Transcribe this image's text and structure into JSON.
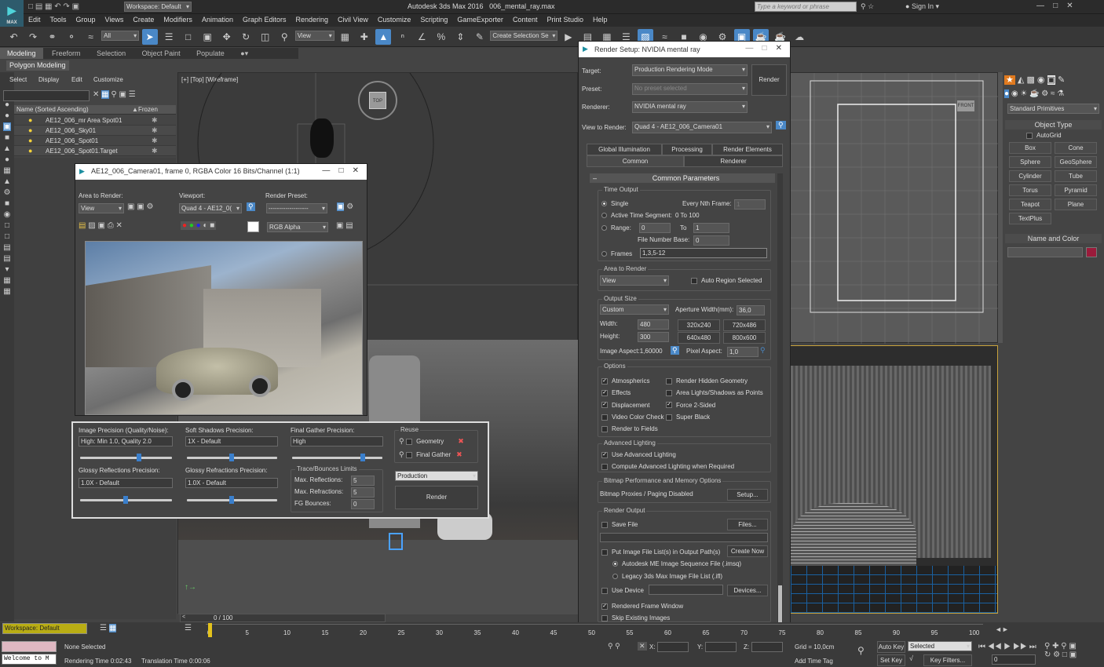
{
  "title": {
    "app": "Autodesk 3ds Max 2016",
    "file": "006_mental_ray.max",
    "workspace": "Workspace: Default",
    "search_placeholder": "Type a keyword or phrase",
    "sign_in": "Sign In"
  },
  "menu": [
    "Edit",
    "Tools",
    "Group",
    "Views",
    "Create",
    "Modifiers",
    "Animation",
    "Graph Editors",
    "Rendering",
    "Civil View",
    "Customize",
    "Scripting",
    "GameExporter",
    "Content",
    "Print Studio",
    "Help"
  ],
  "toolbar": {
    "filter": "All",
    "refcoord": "View",
    "selection_set": "Create Selection Se"
  },
  "ribbon": {
    "tabs": [
      "Modeling",
      "Freeform",
      "Selection",
      "Object Paint",
      "Populate"
    ],
    "sub": "Polygon Modeling"
  },
  "explorer": {
    "menu": [
      "Select",
      "Display",
      "Edit",
      "Customize"
    ],
    "col_name": "Name (Sorted Ascending)",
    "col_frozen": "Frozen",
    "rows": [
      "AE12_006_mr Area Spot01",
      "AE12_006_Sky01",
      "AE12_006_Spot01",
      "AE12_006_Spot01.Target"
    ]
  },
  "viewport": {
    "label": "[+] [Top] [Wireframe]",
    "cube": "TOP",
    "timeline": "0 / 100",
    "front": "FRONT"
  },
  "frame_window": {
    "title": "AE12_006_Camera01, frame 0, RGBA Color 16 Bits/Channel (1:1)",
    "area_label": "Area to Render:",
    "area_value": "View",
    "viewport_label": "Viewport:",
    "viewport_value": "Quad 4 - AE12_0(",
    "preset_label": "Render Preset:",
    "preset_value": "-------------------",
    "channel": "RGB Alpha"
  },
  "render_panel": {
    "image_precision_label": "Image Precision (Quality/Noise):",
    "image_precision": "High: Min 1.0, Quality 2.0",
    "soft_shadows_label": "Soft Shadows Precision:",
    "soft_shadows": "1X - Default",
    "final_gather_label": "Final Gather Precision:",
    "final_gather": "High",
    "reuse": "Reuse",
    "geometry": "Geometry",
    "final_gather_cb": "Final Gather",
    "glossy_refl_label": "Glossy Reflections Precision:",
    "glossy_refl": "1.0X - Default",
    "glossy_refr_label": "Glossy Refractions Precision:",
    "glossy_refr": "1.0X - Default",
    "trace_label": "Trace/Bounces Limits",
    "max_refl": "Max. Reflections:",
    "max_refl_v": "5",
    "max_refr": "Max. Refractions:",
    "max_refr_v": "5",
    "fg_bounces": "FG Bounces:",
    "fg_bounces_v": "0",
    "mode": "Production",
    "render": "Render"
  },
  "render_setup": {
    "title": "Render Setup: NVIDIA mental ray",
    "target_label": "Target:",
    "target": "Production Rendering Mode",
    "preset_label": "Preset:",
    "preset": "No preset selected",
    "renderer_label": "Renderer:",
    "renderer": "NVIDIA mental ray",
    "view_label": "View to Render:",
    "view": "Quad 4 - AE12_006_Camera01",
    "render_btn": "Render",
    "tabs_row1": [
      "Global Illumination",
      "Processing",
      "Render Elements"
    ],
    "tabs_row2": [
      "Common",
      "Renderer"
    ],
    "rollout": "Common Parameters",
    "time_output": "Time Output",
    "single": "Single",
    "every_nth": "Every Nth Frame:",
    "every_nth_v": "1",
    "active_segment": "Active Time Segment:",
    "active_segment_v": "0 To 100",
    "range": "Range:",
    "range_from": "0",
    "range_to_label": "To",
    "range_to": "1",
    "file_number_base": "File Number Base:",
    "file_number_base_v": "0",
    "frames": "Frames",
    "frames_v": "1,3,5-12",
    "area_to_render": "Area to Render",
    "area_value": "View",
    "auto_region": "Auto Region Selected",
    "output_size": "Output Size",
    "size_preset": "Custom",
    "aperture": "Aperture Width(mm):",
    "aperture_v": "36,0",
    "width_label": "Width:",
    "width": "480",
    "height_label": "Height:",
    "height": "300",
    "presets": [
      "320x240",
      "720x486",
      "640x480",
      "800x600"
    ],
    "image_aspect": "Image Aspect:1,60000",
    "pixel_aspect": "Pixel Aspect:",
    "pixel_aspect_v": "1,0",
    "options": "Options",
    "opts_left": [
      "Atmospherics",
      "Effects",
      "Displacement",
      "Video Color Check",
      "Render to Fields"
    ],
    "opts_left_checked": [
      true,
      true,
      true,
      false,
      false
    ],
    "opts_right": [
      "Render Hidden Geometry",
      "Area Lights/Shadows as Points",
      "Force 2-Sided",
      "Super Black"
    ],
    "opts_right_checked": [
      false,
      false,
      true,
      false
    ],
    "adv_lighting": "Advanced Lighting",
    "use_adv": "Use Advanced Lighting",
    "compute_adv": "Compute Advanced Lighting when Required",
    "bitmap_perf": "Bitmap Performance and Memory Options",
    "bitmap_proxies": "Bitmap Proxies / Paging Disabled",
    "setup": "Setup...",
    "render_output": "Render Output",
    "save_file": "Save File",
    "files": "Files...",
    "put_image": "Put Image File List(s) in Output Path(s)",
    "create_now": "Create Now",
    "autodesk_me": "Autodesk ME Image Sequence File (.imsq)",
    "legacy": "Legacy 3ds Max Image File List (.ifl)",
    "use_device": "Use Device",
    "devices": "Devices...",
    "rendered_frame": "Rendered Frame Window",
    "skip_existing": "Skip Existing Images"
  },
  "command_panel": {
    "category": "Standard Primitives",
    "object_type": "Object Type",
    "autogrid": "AutoGrid",
    "buttons": [
      "Box",
      "Cone",
      "Sphere",
      "GeoSphere",
      "Cylinder",
      "Tube",
      "Torus",
      "Pyramid",
      "Teapot",
      "Plane",
      "TextPlus"
    ],
    "name_color": "Name and Color",
    "swatch": "#9b1b3b"
  },
  "status": {
    "workspace": "Workspace: Default",
    "none_selected": "None Selected",
    "welcome": "Welcome to M",
    "render_time": "Rendering Time  0:02:43",
    "translation_time": "Translation Time  0:00:06",
    "x": "X:",
    "y": "Y:",
    "z": "Z:",
    "grid": "Grid = 10,0cm",
    "auto_key": "Auto Key",
    "selected": "Selected",
    "set_key": "Set Key",
    "key_filters": "Key Filters...",
    "add_time_tag": "Add Time Tag",
    "frame": "0"
  },
  "timeline_ticks": [
    "0",
    "5",
    "10",
    "15",
    "20",
    "25",
    "30",
    "35",
    "40",
    "45",
    "50",
    "55",
    "60",
    "65",
    "70",
    "75",
    "80",
    "85",
    "90",
    "95",
    "100"
  ]
}
